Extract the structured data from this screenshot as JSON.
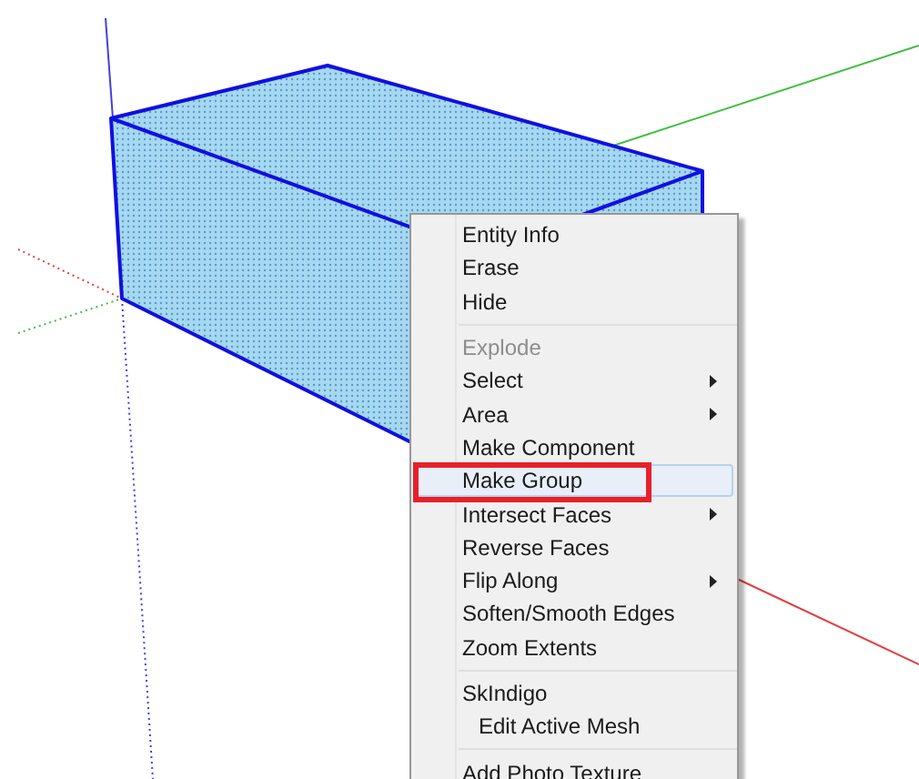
{
  "context_menu": {
    "items": [
      {
        "kind": "item",
        "label": "Entity Info",
        "disabled": false,
        "submenu": false,
        "selected": false,
        "annotated": false
      },
      {
        "kind": "item",
        "label": "Erase",
        "disabled": false,
        "submenu": false,
        "selected": false,
        "annotated": false
      },
      {
        "kind": "item",
        "label": "Hide",
        "disabled": false,
        "submenu": false,
        "selected": false,
        "annotated": false
      },
      {
        "kind": "separator"
      },
      {
        "kind": "item",
        "label": "Explode",
        "disabled": true,
        "submenu": false,
        "selected": false,
        "annotated": false
      },
      {
        "kind": "item",
        "label": "Select",
        "disabled": false,
        "submenu": true,
        "selected": false,
        "annotated": false
      },
      {
        "kind": "item",
        "label": "Area",
        "disabled": false,
        "submenu": true,
        "selected": false,
        "annotated": false
      },
      {
        "kind": "item",
        "label": "Make Component",
        "disabled": false,
        "submenu": false,
        "selected": false,
        "annotated": false
      },
      {
        "kind": "item",
        "label": "Make Group",
        "disabled": false,
        "submenu": false,
        "selected": true,
        "annotated": true
      },
      {
        "kind": "item",
        "label": "Intersect Faces",
        "disabled": false,
        "submenu": true,
        "selected": false,
        "annotated": false
      },
      {
        "kind": "item",
        "label": "Reverse Faces",
        "disabled": false,
        "submenu": false,
        "selected": false,
        "annotated": false
      },
      {
        "kind": "item",
        "label": "Flip Along",
        "disabled": false,
        "submenu": true,
        "selected": false,
        "annotated": false
      },
      {
        "kind": "item",
        "label": "Soften/Smooth Edges",
        "disabled": false,
        "submenu": false,
        "selected": false,
        "annotated": false
      },
      {
        "kind": "item",
        "label": "Zoom Extents",
        "disabled": false,
        "submenu": false,
        "selected": false,
        "annotated": false
      },
      {
        "kind": "separator"
      },
      {
        "kind": "item",
        "label": "SkIndigo",
        "disabled": false,
        "submenu": false,
        "selected": false,
        "annotated": false
      },
      {
        "kind": "nested",
        "label": "Edit Active Mesh",
        "disabled": false,
        "submenu": false,
        "selected": false,
        "annotated": false
      },
      {
        "kind": "separator"
      },
      {
        "kind": "item",
        "label": "Add Photo Texture",
        "disabled": false,
        "submenu": false,
        "selected": false,
        "annotated": false
      }
    ]
  }
}
